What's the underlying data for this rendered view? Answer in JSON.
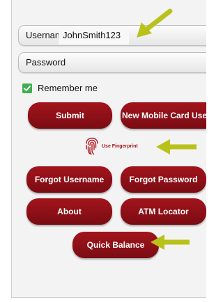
{
  "login": {
    "username_label": "Username",
    "username_value": "JohnSmith123",
    "password_label": "Password",
    "remember_label": "Remember me",
    "remember_checked": true
  },
  "buttons": {
    "submit": "Submit",
    "new_mobile_card_user": "New Mobile Card User",
    "fingerprint": "Use Fingerprint",
    "forgot_username": "Forgot Username",
    "forgot_password": "Forgot Password",
    "about": "About",
    "atm_locator": "ATM Locator",
    "quick_balance": "Quick Balance"
  },
  "colors": {
    "button_red": "#8e1118",
    "checkbox_green": "#3fae4f",
    "annotation_arrow": "#b9c21b"
  },
  "icons": {
    "fingerprint": "fingerprint-icon",
    "check": "checkmark-icon",
    "arrow": "annotation-arrow-icon"
  }
}
